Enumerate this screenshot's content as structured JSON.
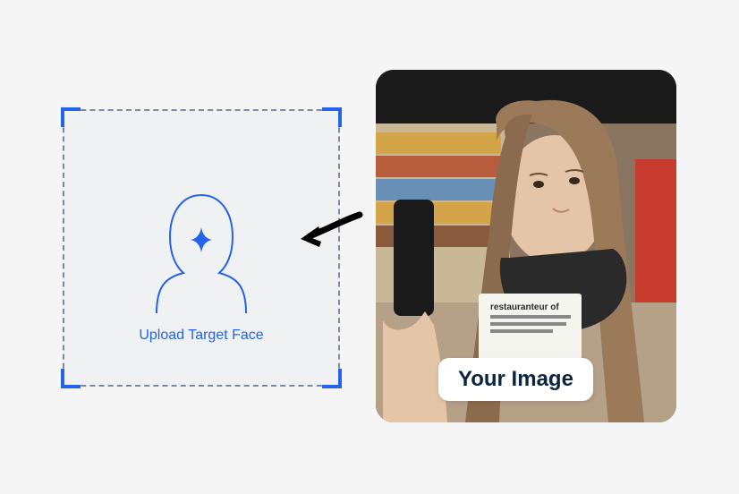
{
  "upload": {
    "label": "Upload Target Face"
  },
  "image": {
    "badge_label": "Your Image"
  }
}
